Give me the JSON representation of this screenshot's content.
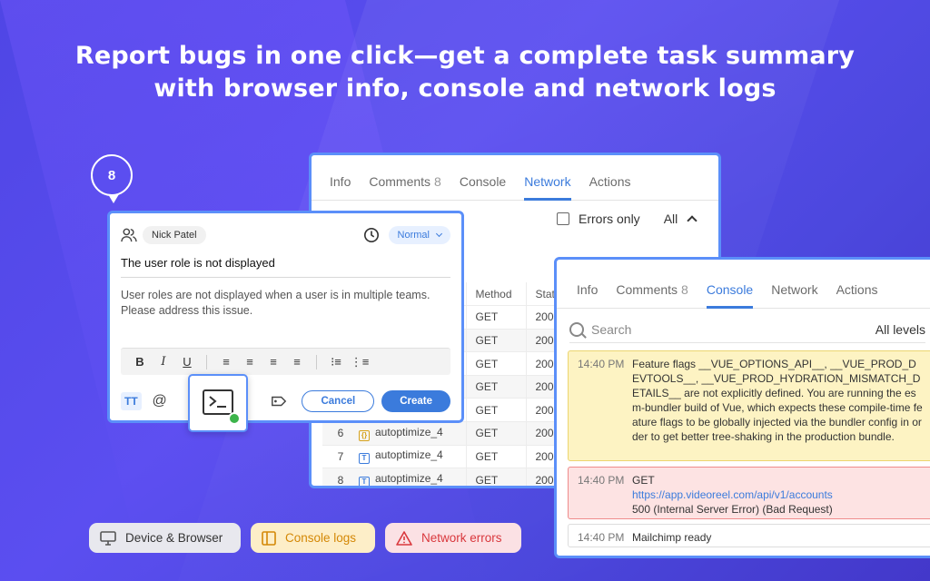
{
  "headline": {
    "line1": "Report bugs in one click—get a complete task summary",
    "line2": "with browser info, console and network logs"
  },
  "bubble": {
    "count": "8"
  },
  "back_panel": {
    "tabs": [
      {
        "label": "Info"
      },
      {
        "label": "Comments",
        "count": "8"
      },
      {
        "label": "Console"
      },
      {
        "label": "Network",
        "active": true
      },
      {
        "label": "Actions"
      }
    ],
    "errors_only_label": "Errors only",
    "all_label": "All",
    "columns": {
      "method": "Method",
      "status": "Stat"
    },
    "rows": [
      {
        "num": "",
        "icon": "",
        "name": "",
        "method": "GET",
        "status": "200"
      },
      {
        "num": "",
        "icon": "",
        "name": "",
        "method": "GET",
        "status": "200"
      },
      {
        "num": "",
        "icon": "",
        "name": "",
        "method": "GET",
        "status": "200"
      },
      {
        "num": "",
        "icon": "",
        "name": "",
        "method": "GET",
        "status": "200"
      },
      {
        "num": "",
        "icon": "",
        "name": "",
        "method": "GET",
        "status": "200"
      },
      {
        "num": "6",
        "icon": "js",
        "name": "autoptimize_4",
        "method": "GET",
        "status": "200"
      },
      {
        "num": "7",
        "icon": "T",
        "name": "autoptimize_4",
        "method": "GET",
        "status": "200"
      },
      {
        "num": "8",
        "icon": "T",
        "name": "autoptimize_4",
        "method": "GET",
        "status": "200"
      }
    ]
  },
  "task_card": {
    "assignee": "Nick Patel",
    "priority": "Normal",
    "title": "The user role is not displayed",
    "description": "User roles are not displayed when a user is in multiple teams. Please address this issue.",
    "cancel_label": "Cancel",
    "create_label": "Create",
    "text_format_label": "TT"
  },
  "console_panel": {
    "tabs": [
      {
        "label": "Info"
      },
      {
        "label": "Comments",
        "count": "8"
      },
      {
        "label": "Console",
        "active": true
      },
      {
        "label": "Network"
      },
      {
        "label": "Actions"
      }
    ],
    "search_placeholder": "Search",
    "levels_label": "All levels",
    "logs": [
      {
        "time": "14:40 PM",
        "type": "warn",
        "text": "Feature flags __VUE_OPTIONS_API__, __VUE_PROD_DEVTOOLS__, __VUE_PROD_HYDRATION_MISMATCH_DETAILS__ are not explicitly defined. You are running the esm-bundler build of Vue, which expects these compile-time feature flags to be globally injected via the bundler config in order to get better tree-shaking in the production bundle."
      },
      {
        "time": "14:40 PM",
        "type": "err",
        "method": "GET",
        "url": "https://app.videoreel.com/api/v1/accounts",
        "status": "500 (Internal Server Error) (Bad Request)"
      },
      {
        "time": "14:40 PM",
        "type": "info",
        "text": "Mailchimp ready"
      }
    ]
  },
  "pills": {
    "device": "Device & Browser",
    "console": "Console logs",
    "network": "Network errors"
  },
  "colors": {
    "accent": "#3b7bdc",
    "frame": "#5b8ff9",
    "background": "#4f46e5"
  }
}
